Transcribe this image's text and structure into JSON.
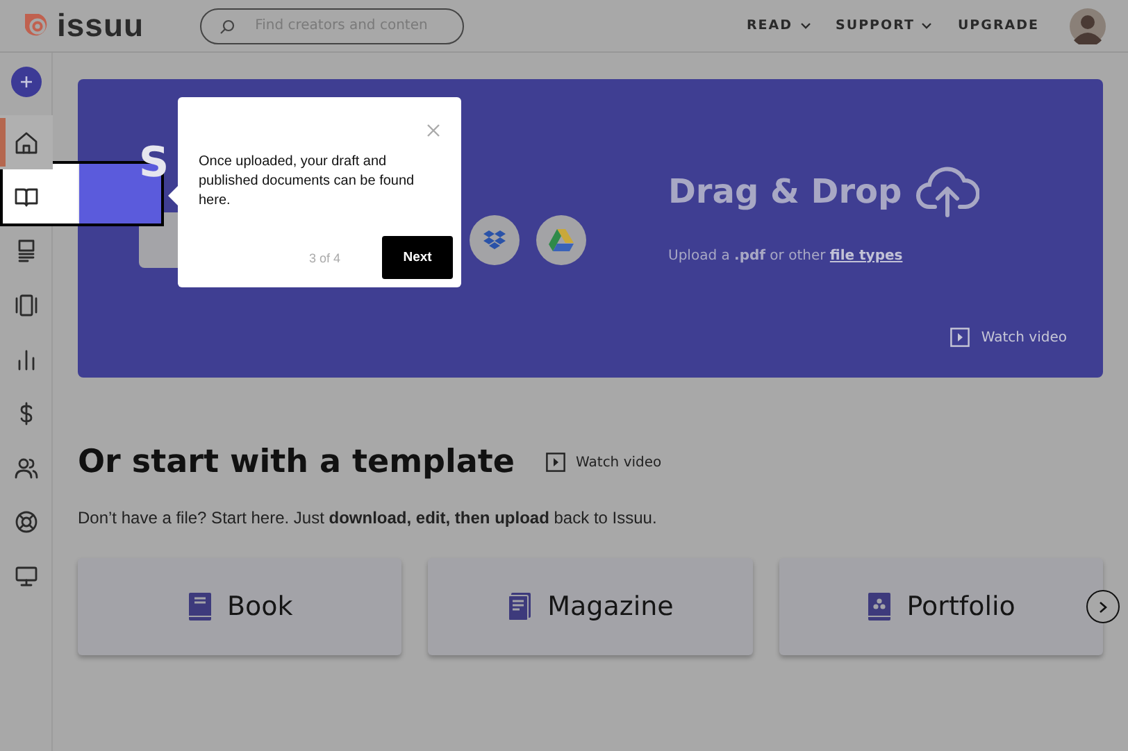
{
  "header": {
    "logo": "issuu",
    "search": {
      "placeholder": "Find creators and conten"
    },
    "nav": [
      {
        "label": "READ",
        "dropdown": true
      },
      {
        "label": "SUPPORT",
        "dropdown": true
      },
      {
        "label": "UPGRADE",
        "dropdown": false
      }
    ]
  },
  "sidebar": {
    "items": [
      {
        "kind": "home",
        "selected": true
      },
      {
        "kind": "book",
        "selected": false
      },
      {
        "kind": "article",
        "selected": false
      },
      {
        "kind": "story",
        "selected": false
      },
      {
        "kind": "stats",
        "selected": false
      },
      {
        "kind": "money",
        "selected": false
      },
      {
        "kind": "people",
        "selected": false
      },
      {
        "kind": "help",
        "selected": false
      },
      {
        "kind": "screen",
        "selected": false
      }
    ]
  },
  "hero": {
    "heading": "S",
    "drag_title": "Drag & Drop",
    "upload_text": "Upload a **.pdf** or other",
    "link": "file types",
    "watch": "Watch video"
  },
  "tour": {
    "text": "Once uploaded, your draft and published documents can be found here.",
    "step": "3 of 4",
    "next": "Next"
  },
  "templates": {
    "title": "Or start with a template",
    "watch": "Watch video",
    "description": "Don’t have a file? Start here. Just **download, edit, then upload** back to Issuu.",
    "cards": [
      {
        "kind": "book",
        "label": "Book"
      },
      {
        "kind": "magazine",
        "label": "Magazine"
      },
      {
        "kind": "portfolio",
        "label": "Portfolio"
      }
    ]
  }
}
